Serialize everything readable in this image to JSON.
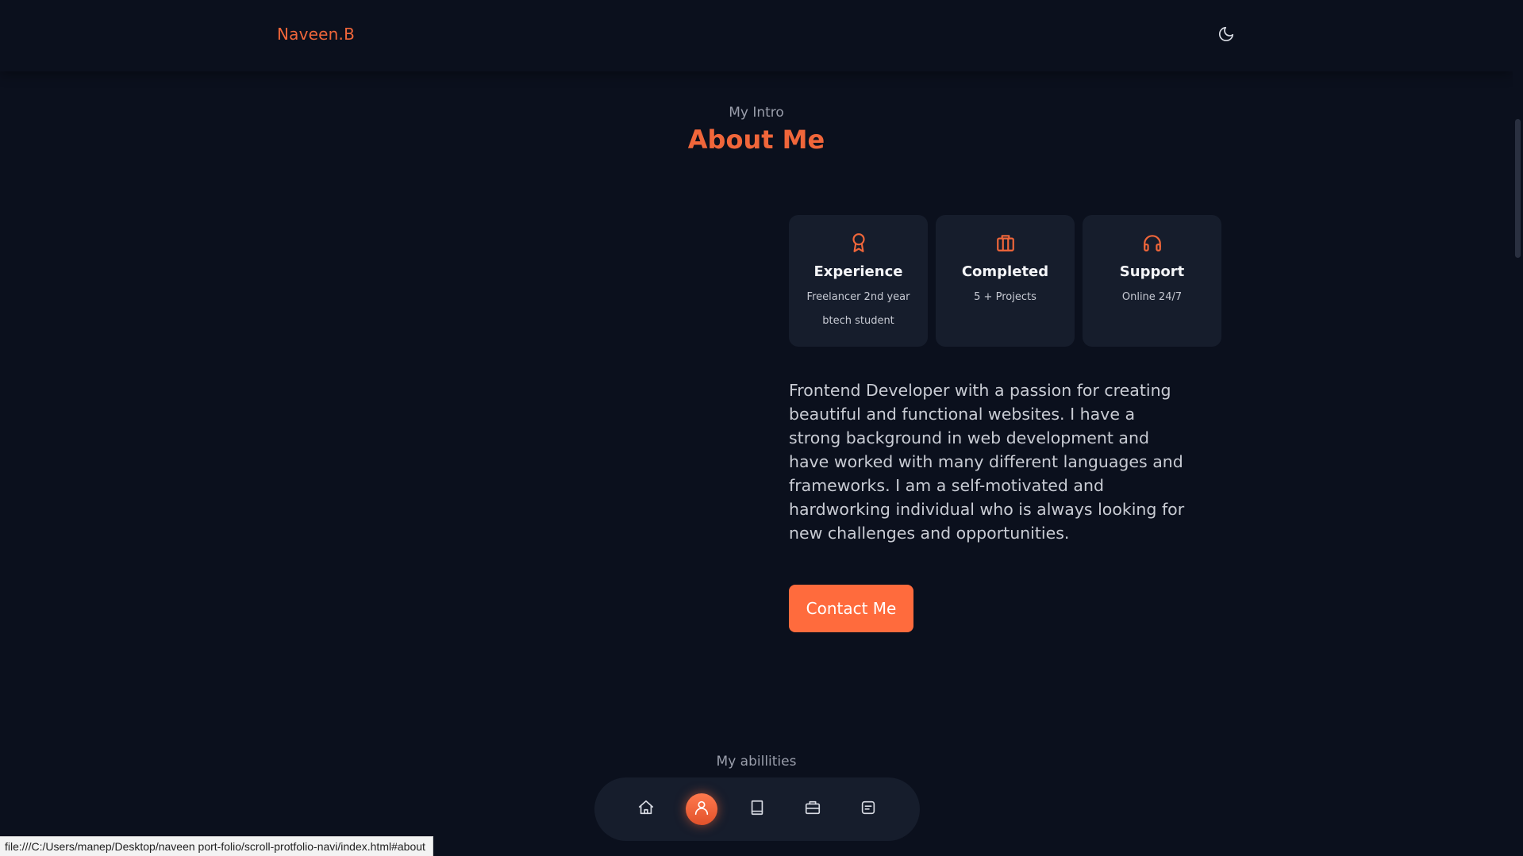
{
  "header": {
    "logo": "Naveen.B",
    "theme_icon": "moon-icon"
  },
  "about": {
    "subtitle": "My Intro",
    "title": "About Me",
    "cards": [
      {
        "icon": "award-icon",
        "title": "Experience",
        "subtitle": "Freelancer 2nd year btech student"
      },
      {
        "icon": "briefcase-icon",
        "title": "Completed",
        "subtitle": "5 + Projects"
      },
      {
        "icon": "headphones-icon",
        "title": "Support",
        "subtitle": "Online 24/7"
      }
    ],
    "description": "Frontend Developer with a passion for creating beautiful and functional websites. I have a strong background in web development and have worked with many different languages and frameworks. I am a self-motivated and hardworking individual who is always looking for new challenges and opportunities.",
    "contact_label": "Contact Me"
  },
  "skills": {
    "subtitle": "My abillities"
  },
  "bottom_nav": {
    "items": [
      {
        "icon": "home-icon",
        "active": false
      },
      {
        "icon": "user-icon",
        "active": true
      },
      {
        "icon": "book-icon",
        "active": false
      },
      {
        "icon": "briefcase-icon",
        "active": false
      },
      {
        "icon": "message-icon",
        "active": false
      }
    ]
  },
  "status_bar": {
    "url": "file:///C:/Users/manep/Desktop/naveen port-folio/scroll-protfolio-navi/index.html#about"
  },
  "colors": {
    "background": "#0b101d",
    "accent": "#f0663a",
    "card": "#161d2c",
    "button": "#ff6b3d"
  }
}
